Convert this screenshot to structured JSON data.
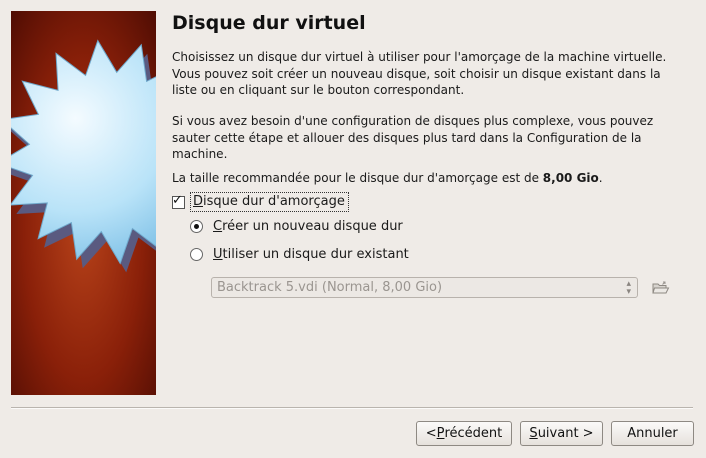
{
  "wizard": {
    "title": "Disque dur virtuel",
    "paragraph1": "Choisissez un disque dur virtuel à utiliser pour l'amorçage de la machine virtuelle. Vous pouvez soit créer un nouveau disque, soit choisir un disque existant dans la liste ou en cliquant sur le bouton correspondant.",
    "paragraph2": "Si vous avez besoin d'une configuration de disques plus complexe, vous pouvez sauter cette étape et allouer des disques plus tard dans la Configuration de la machine.",
    "recommended_prefix": "La taille recommandée pour le disque dur d'amorçage est de ",
    "recommended_size": "8,00 Gio",
    "recommended_suffix": "."
  },
  "boot_disk": {
    "checkbox_checked": true,
    "label_mnemonic": "D",
    "label_rest": "isque dur d'amorçage",
    "options": [
      {
        "mnemonic": "C",
        "rest": "réer un nouveau disque dur",
        "selected": true
      },
      {
        "mnemonic": "U",
        "rest": "tiliser un disque dur existant",
        "selected": false
      }
    ],
    "existing_disk_value": "Backtrack 5.vdi (Normal, 8,00 Gio)"
  },
  "buttons": {
    "back_prefix": "< ",
    "back_mnemonic": "P",
    "back_rest": "récédent",
    "next_mnemonic": "S",
    "next_rest": "uivant >",
    "cancel": "Annuler"
  },
  "icons": {
    "banner": "starburst-banner-icon",
    "folder": "folder-open-icon"
  }
}
